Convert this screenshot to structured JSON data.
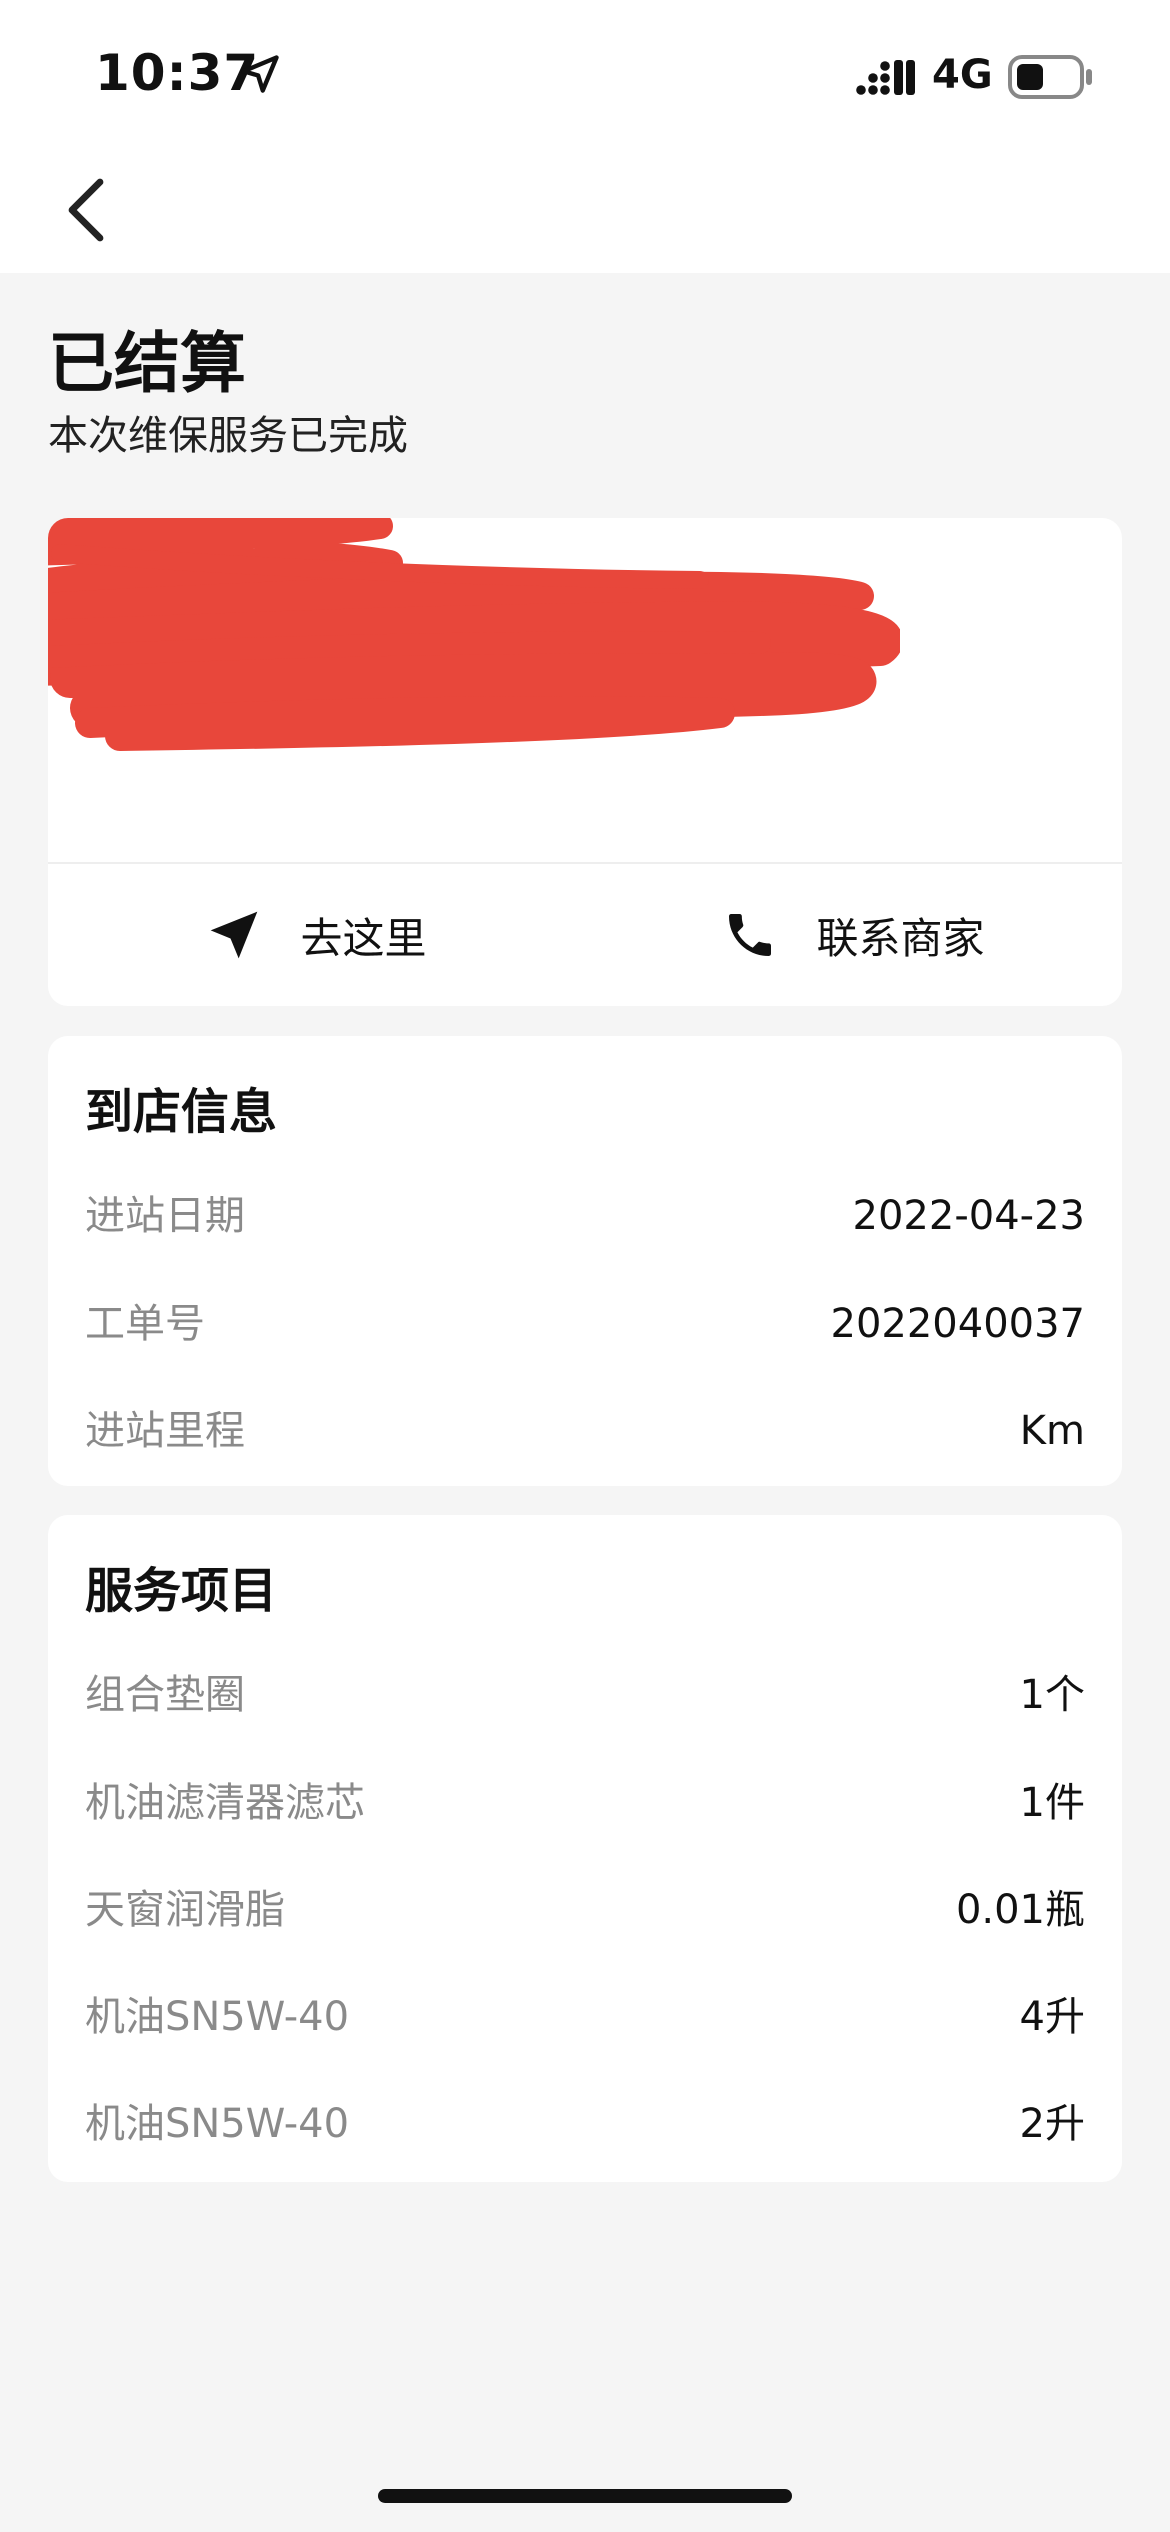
{
  "status_bar": {
    "time": "10:37",
    "network": "4G",
    "icons": [
      "location-arrow-icon",
      "signal-icon",
      "battery-icon"
    ]
  },
  "nav": {
    "back_icon": "chevron-left-icon"
  },
  "order": {
    "status_title": "已结算",
    "status_subtitle": "本次维保服务已完成"
  },
  "merchant": {
    "redacted": true,
    "actions": [
      {
        "label": "去这里",
        "icon": "navigation-arrow-icon"
      },
      {
        "label": "联系商家",
        "icon": "phone-icon"
      }
    ]
  },
  "visit_info": {
    "title": "到店信息",
    "rows": [
      {
        "label": "进站日期",
        "value": "2022-04-23"
      },
      {
        "label": "工单号",
        "value": "2022040037"
      },
      {
        "label": "进站里程",
        "value": "Km"
      }
    ]
  },
  "services": {
    "title": "服务项目",
    "rows": [
      {
        "label": "组合垫圈",
        "value": "1个"
      },
      {
        "label": "机油滤清器滤芯",
        "value": "1件"
      },
      {
        "label": "天窗润滑脂",
        "value": "0.01瓶"
      },
      {
        "label": "机油SN5W-40",
        "value": "4升"
      },
      {
        "label": "机油SN5W-40",
        "value": "2升"
      }
    ]
  },
  "colors": {
    "page_background": "#f5f5f5",
    "card_background": "#ffffff",
    "redaction": "#e8473b",
    "label_gray": "#8a8a8a"
  }
}
